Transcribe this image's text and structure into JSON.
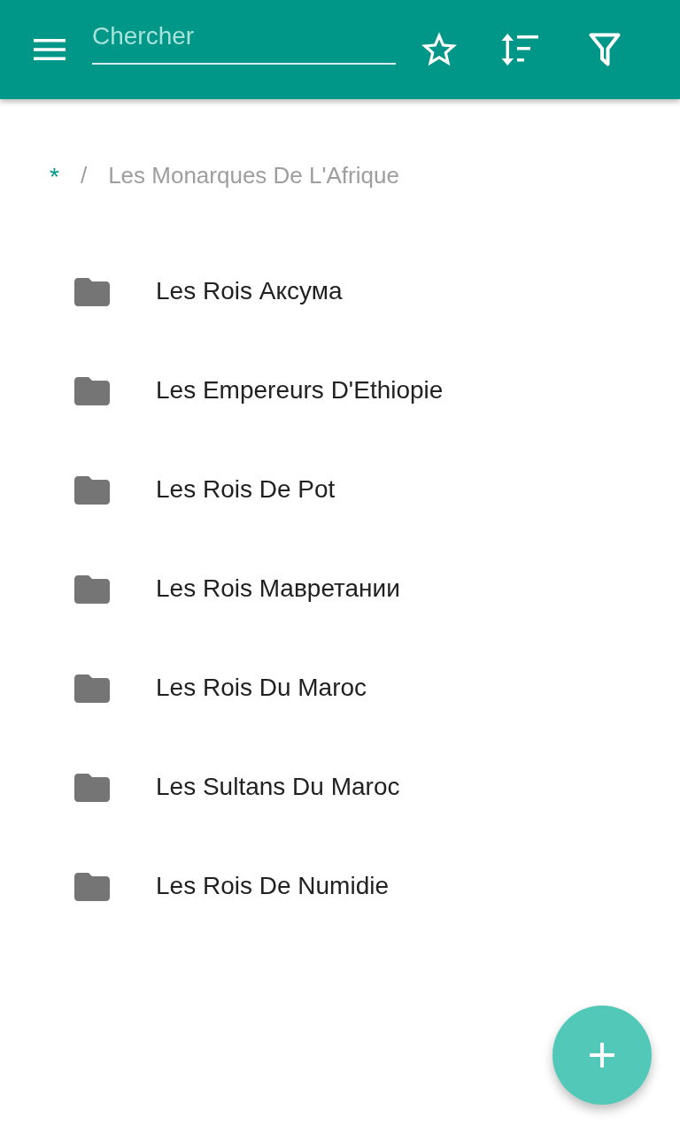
{
  "toolbar": {
    "search": {
      "placeholder": "Chercher"
    }
  },
  "breadcrumb": {
    "root": "*",
    "separator": "/",
    "current": "Les Monarques De L'Afrique"
  },
  "folders": [
    {
      "name": "Les Rois Аксума"
    },
    {
      "name": "Les Empereurs D'Ethiopie"
    },
    {
      "name": "Les Rois De Pot"
    },
    {
      "name": "Les Rois Мавретании"
    },
    {
      "name": "Les Rois Du Maroc"
    },
    {
      "name": "Les Sultans Du Maroc"
    },
    {
      "name": "Les Rois De Numidie"
    }
  ]
}
